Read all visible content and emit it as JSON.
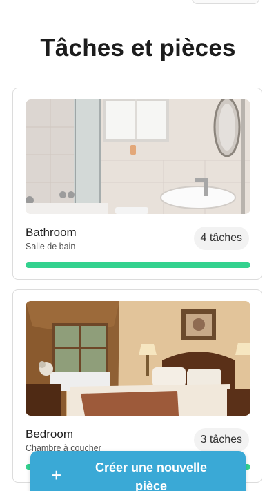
{
  "page": {
    "title": "Tâches et pièces"
  },
  "rooms": [
    {
      "name": "Bathroom",
      "subtitle": "Salle de bain",
      "tasks_label": "4 tâches",
      "progress": 1.0,
      "image_icon": "bathroom-photo"
    },
    {
      "name": "Bedroom",
      "subtitle": "Chambre à coucher",
      "tasks_label": "3 tâches",
      "progress": 1.0,
      "image_icon": "bedroom-photo"
    }
  ],
  "fab": {
    "icon": "plus-icon",
    "label": "Créer une nouvelle pièce"
  },
  "colors": {
    "progress": "#33d28f",
    "fab": "#3aa9d6"
  }
}
